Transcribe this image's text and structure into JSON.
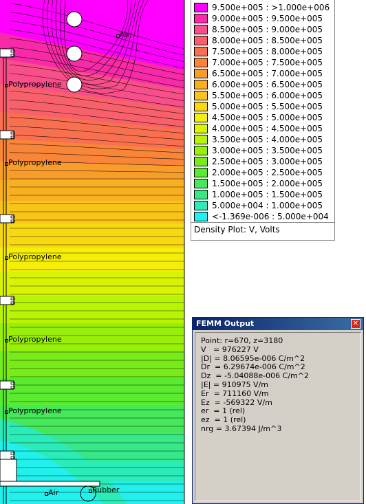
{
  "plot": {
    "labels": [
      {
        "text": "Air"
      },
      {
        "text": "Polypropylene"
      },
      {
        "text": "Polypropylene"
      },
      {
        "text": "Polypropylene"
      },
      {
        "text": "Polypropylene"
      },
      {
        "text": "Polypropylene"
      },
      {
        "text": "Air"
      },
      {
        "text": "Rubber"
      }
    ]
  },
  "legend": {
    "entries": [
      {
        "text": "9.500e+005 : >1.000e+006",
        "color": "#ff00ff"
      },
      {
        "text": "9.000e+005 : 9.500e+005",
        "color": "#f82aa8"
      },
      {
        "text": "8.500e+005 : 9.000e+005",
        "color": "#f84e8a"
      },
      {
        "text": "8.000e+005 : 8.500e+005",
        "color": "#f8606c"
      },
      {
        "text": "7.500e+005 : 8.000e+005",
        "color": "#f87050"
      },
      {
        "text": "7.000e+005 : 7.500e+005",
        "color": "#f88538"
      },
      {
        "text": "6.500e+005 : 7.000e+005",
        "color": "#f89c2a"
      },
      {
        "text": "6.000e+005 : 6.500e+005",
        "color": "#f8b020"
      },
      {
        "text": "5.500e+005 : 6.000e+005",
        "color": "#f8c418"
      },
      {
        "text": "5.000e+005 : 5.500e+005",
        "color": "#f8d810"
      },
      {
        "text": "4.500e+005 : 5.000e+005",
        "color": "#f4ee08"
      },
      {
        "text": "4.000e+005 : 4.500e+005",
        "color": "#d8f404"
      },
      {
        "text": "3.500e+005 : 4.000e+005",
        "color": "#b8f404"
      },
      {
        "text": "3.000e+005 : 3.500e+005",
        "color": "#98f008"
      },
      {
        "text": "2.500e+005 : 3.000e+005",
        "color": "#78ec18"
      },
      {
        "text": "2.000e+005 : 2.500e+005",
        "color": "#5aea30"
      },
      {
        "text": "1.500e+005 : 2.000e+005",
        "color": "#44e858"
      },
      {
        "text": "1.000e+005 : 1.500e+005",
        "color": "#36e888"
      },
      {
        "text": "5.000e+004 : 1.000e+005",
        "color": "#2aecb8"
      },
      {
        "text": "<-1.369e-006 : 5.000e+004",
        "color": "#22f0ec"
      }
    ],
    "title": "Density Plot: V, Volts"
  },
  "output_window": {
    "title": "FEMM Output",
    "close_glyph": "✕",
    "lines": [
      "Point: r=670, z=3180",
      "V   = 976227 V",
      "|D| = 8.06595e-006 C/m^2",
      "Dr  = 6.29674e-006 C/m^2",
      "Dz  = -5.04088e-006 C/m^2",
      "|E| = 910975 V/m",
      "Er  = 711160 V/m",
      "Ez  = -569322 V/m",
      "er  = 1 (rel)",
      "ez  = 1 (rel)",
      "nrg = 3.67394 J/m^3"
    ]
  }
}
